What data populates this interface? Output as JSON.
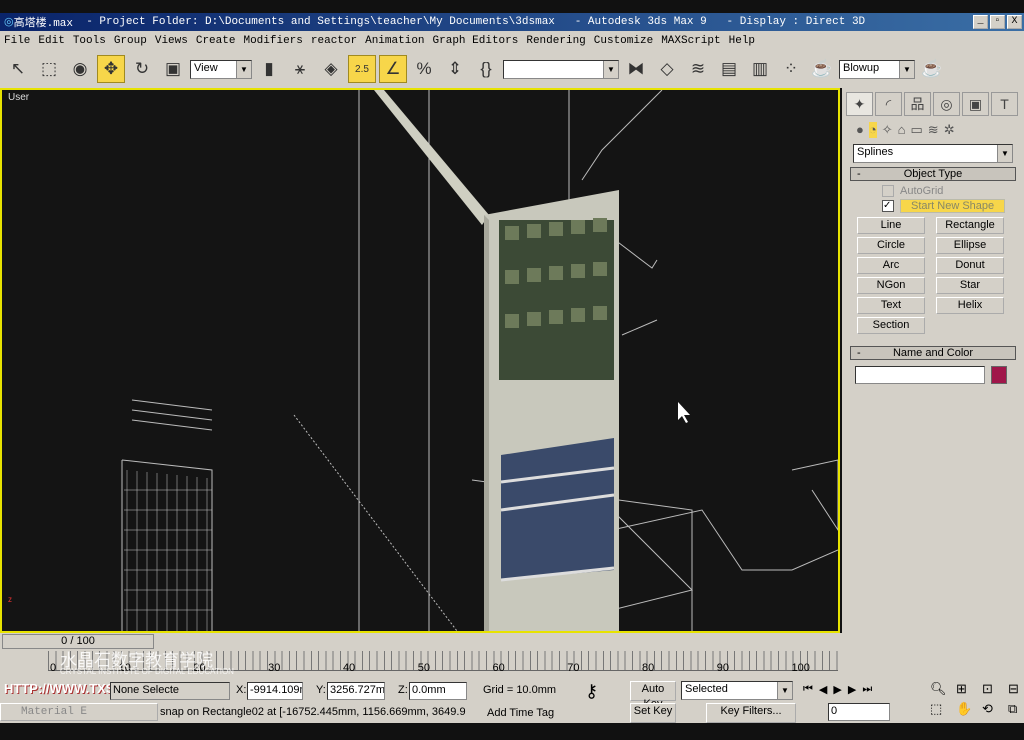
{
  "titlebar": {
    "file": "高塔楼.max",
    "project": "  - Project Folder: D:\\Documents and Settings\\teacher\\My Documents\\3dsmax",
    "app": "   - Autodesk 3ds Max 9",
    "display": "   - Display : Direct 3D",
    "min": "_",
    "restore": "▫",
    "close": "X"
  },
  "menu": [
    "File",
    "Edit",
    "Tools",
    "Group",
    "Views",
    "Create",
    "Modifiers",
    "reactor",
    "Animation",
    "Graph Editors",
    "Rendering",
    "Customize",
    "MAXScript",
    "Help"
  ],
  "toolbar": {
    "view_dropdown": "View",
    "named_selection": "",
    "render_dropdown": "Blowup",
    "snap_value": "2.5"
  },
  "viewport": {
    "label": "User"
  },
  "command_panel": {
    "category": "Splines",
    "object_type": "Object Type",
    "autogrid": "AutoGrid",
    "start_new_shape": "Start New Shape",
    "buttons": [
      "Line",
      "Rectangle",
      "Circle",
      "Ellipse",
      "Arc",
      "Donut",
      "NGon",
      "Star",
      "Text",
      "Helix",
      "Section"
    ],
    "name_and_color": "Name and Color",
    "name_value": "",
    "color": "#a0164a"
  },
  "timeline": {
    "frame": "0 / 100",
    "ticks": [
      "0",
      "10",
      "20",
      "30",
      "40",
      "50",
      "60",
      "70",
      "80",
      "90",
      "100"
    ]
  },
  "status": {
    "selection": "None Selecte",
    "x": "-9914.109r",
    "y": "3256.727m",
    "z": "0.0mm",
    "grid": "Grid = 10.0mm",
    "prompt": "snap on Rectangle02 at [-16752.445mm, 1156.669mm, 3649.9",
    "add_time_tag": "Add Time Tag",
    "auto_key": "Auto Key",
    "set_key": "Set Key",
    "key_mode": "Selected",
    "key_filters": "Key Filters...",
    "current_frame": "0",
    "minimized_window": "Material E"
  },
  "watermark": {
    "title": "水晶石数字教育学院",
    "subtitle": "CRYSTAL INSTITUTE OF DIGITAL EDUCATION",
    "url": "HTTP://WWW.TXSJ.COM.CN"
  }
}
